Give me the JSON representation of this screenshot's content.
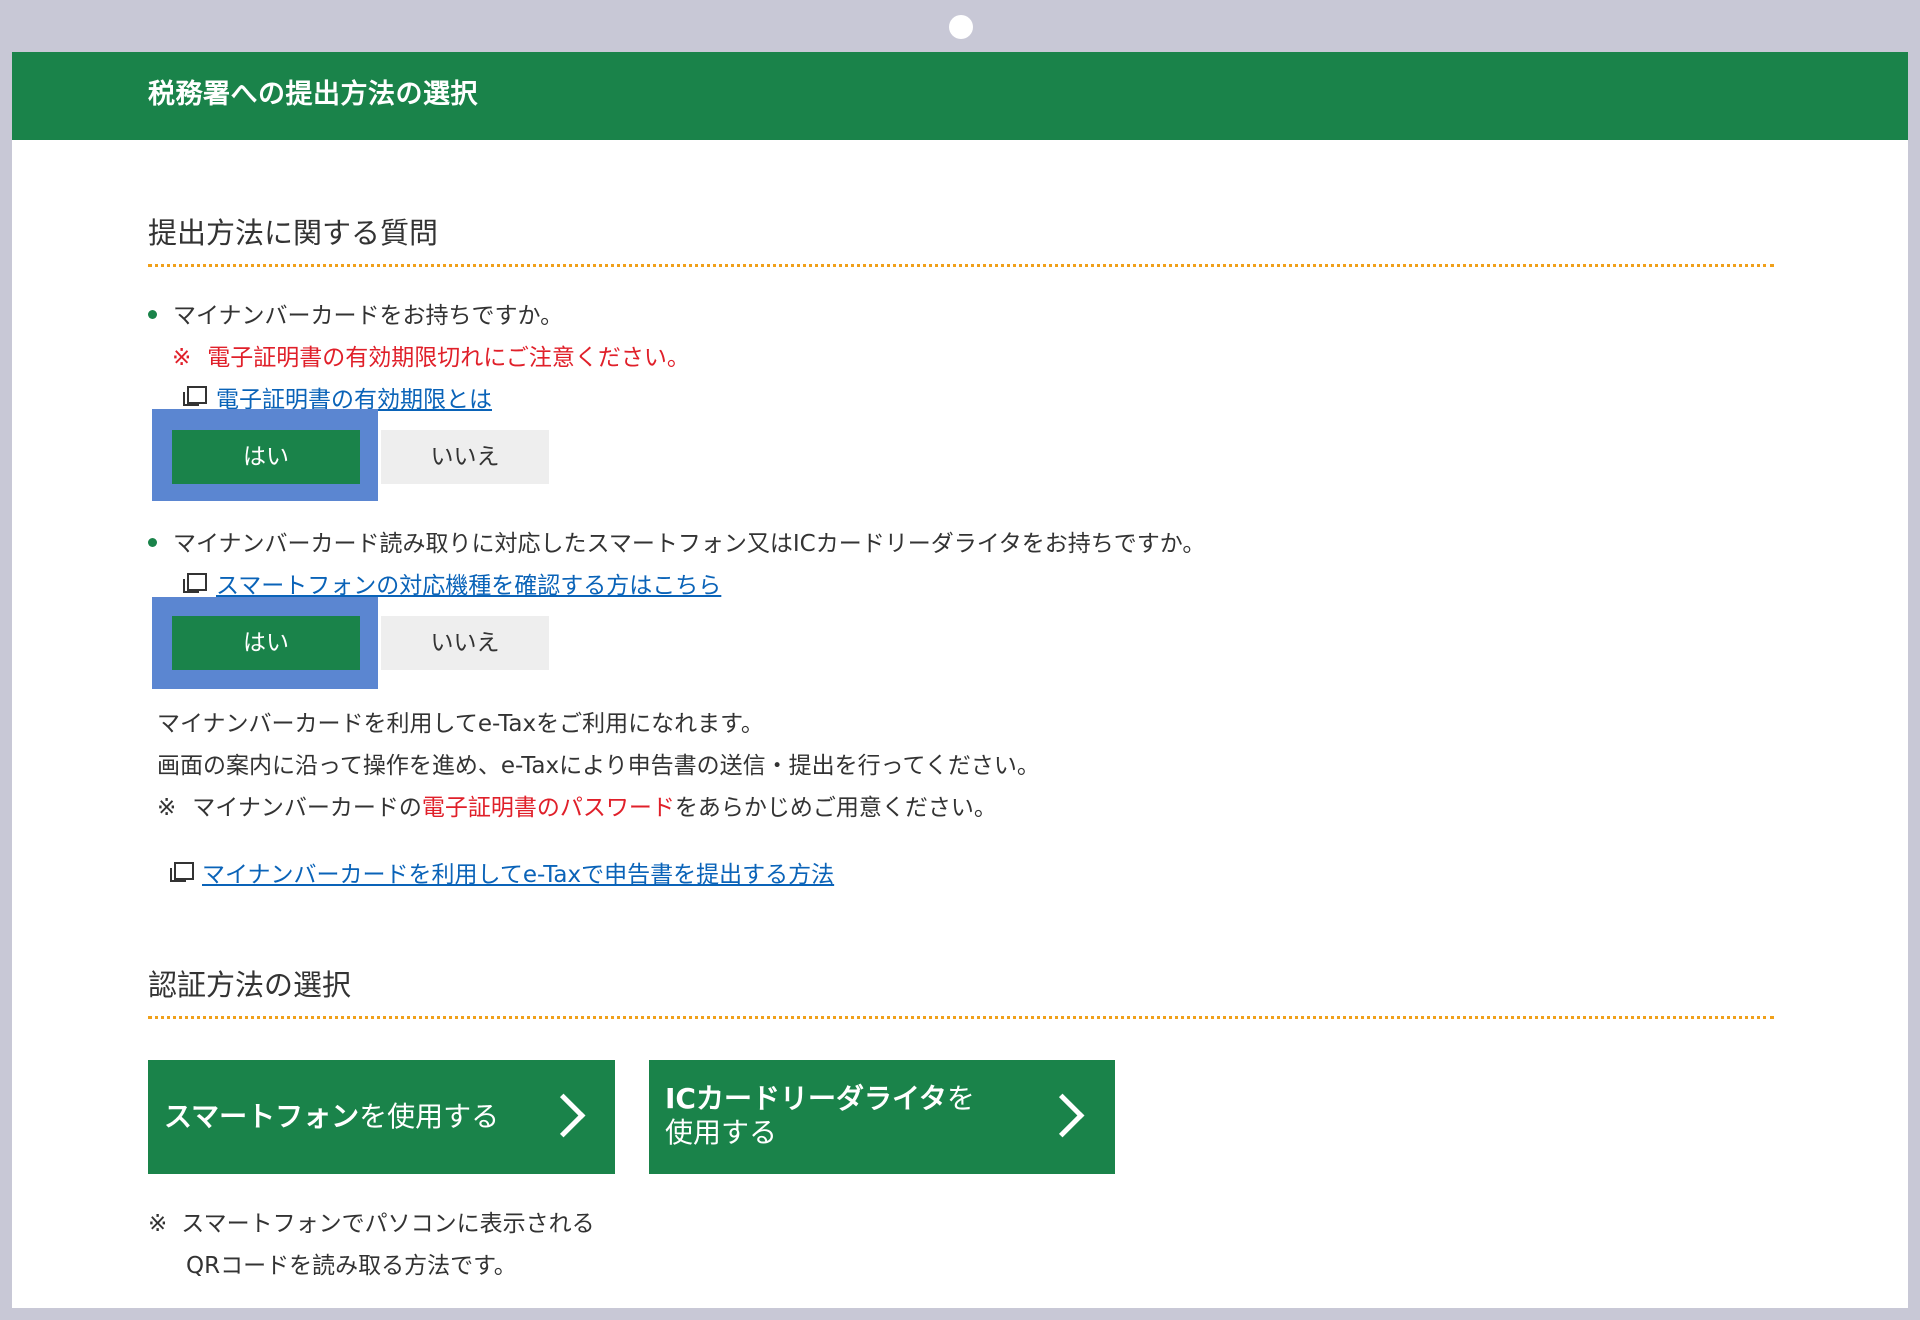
{
  "header": {
    "title": "税務署への提出方法の選択"
  },
  "section1": {
    "title": "提出方法に関する質問",
    "q1": {
      "text": "マイナンバーカードをお持ちですか。",
      "warning_mark": "※",
      "warning": "電子証明書の有効期限切れにご注意ください。",
      "link": "電子証明書の有効期限とは",
      "yes": "はい",
      "no": "いいえ"
    },
    "q2": {
      "text": "マイナンバーカード読み取りに対応したスマートフォン又はICカードリーダライタをお持ちですか。",
      "link": "スマートフォンの対応機種を確認する方はこちら",
      "yes": "はい",
      "no": "いいえ"
    },
    "info": {
      "line1": "マイナンバーカードを利用してe-Taxをご利用になれます。",
      "line2": "画面の案内に沿って操作を進め、e-Taxにより申告書の送信・提出を行ってください。",
      "line3_mark": "※",
      "line3_a": "マイナンバーカードの",
      "line3_red": "電子証明書のパスワード",
      "line3_b": "をあらかじめご用意ください。",
      "link": "マイナンバーカードを利用してe-Taxで申告書を提出する方法"
    }
  },
  "section2": {
    "title": "認証方法の選択",
    "smartphone_btn": {
      "bold": "スマートフォン",
      "rest": "を使用する"
    },
    "icreader_btn": {
      "bold": "ICカードリーダライタ",
      "rest1": "を",
      "rest2": "使用する"
    },
    "note_mark": "※",
    "note_line1": "スマートフォンでパソコンに表示される",
    "note_line2": "QRコードを読み取る方法です。"
  },
  "colors": {
    "primary_green": "#1a834a",
    "accent_orange": "#f0a01a",
    "warning_red": "#e0202a",
    "link_blue": "#0a63b8",
    "selection_blue": "#5b86d1"
  }
}
